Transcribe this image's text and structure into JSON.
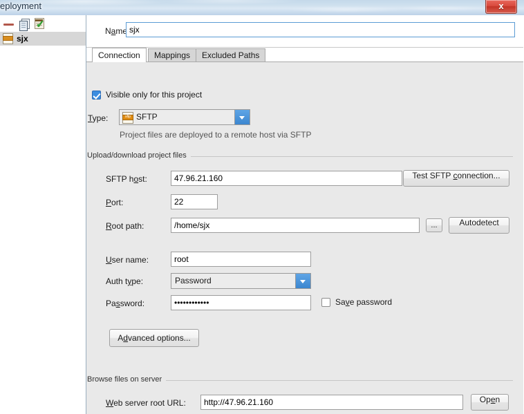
{
  "window": {
    "title": "eployment",
    "close_label": "x"
  },
  "sidebar": {
    "toolbar": [
      {
        "name": "remove-server-icon",
        "label": "Remove"
      },
      {
        "name": "copy-server-icon",
        "label": "Copy"
      },
      {
        "name": "set-default-server-icon",
        "label": "Use as default"
      }
    ],
    "items": [
      {
        "label": "sjx",
        "icon": "sftp-server-icon",
        "selected": true
      }
    ]
  },
  "name_field": {
    "label_pre": "N",
    "label_mn": "a",
    "label_post": "me:",
    "value": "sjx"
  },
  "tabs": [
    {
      "label": "Connection",
      "active": true
    },
    {
      "label": "Mappings",
      "active": false
    },
    {
      "label": "Excluded Paths",
      "active": false
    }
  ],
  "connection": {
    "visible_only_checkbox": {
      "label": "Visible only for this project",
      "checked": true
    },
    "type": {
      "label_pre": "",
      "label_mn": "T",
      "label_post": "ype:",
      "value": "SFTP",
      "icon": "sftp-file-icon",
      "description": "Project files are deployed to a remote host via SFTP"
    },
    "upload_group": {
      "title": "Upload/download project files",
      "host": {
        "label_pre": "SFTP h",
        "label_mn": "o",
        "label_post": "st:",
        "value": "47.96.21.160"
      },
      "test_button": {
        "label_pre": "Test SFTP ",
        "label_mn": "c",
        "label_post": "onnection..."
      },
      "port": {
        "label_pre": "",
        "label_mn": "P",
        "label_post": "ort:",
        "value": "22"
      },
      "root_path": {
        "label_pre": "",
        "label_mn": "R",
        "label_post": "oot path:",
        "value": "/home/sjx",
        "browse_label": "..."
      },
      "autodetect_button": {
        "label": "Autodetect"
      },
      "user_name": {
        "label_pre": "",
        "label_mn": "U",
        "label_post": "ser name:",
        "value": "root"
      },
      "auth_type": {
        "label_pre": "Auth t",
        "label_mn": "y",
        "label_post": "pe:",
        "value": "Password"
      },
      "password": {
        "label_pre": "Pa",
        "label_mn": "s",
        "label_post": "sword:",
        "value": "••••••••••••"
      },
      "save_password": {
        "label_pre": "Sa",
        "label_mn": "v",
        "label_post": "e password",
        "checked": false
      },
      "advanced_button": {
        "label_pre": "A",
        "label_mn": "d",
        "label_post": "vanced options..."
      }
    },
    "browse_group": {
      "title": "Browse files on server",
      "web_root": {
        "label_pre": "",
        "label_mn": "W",
        "label_post": "eb server root URL:",
        "value": "http://47.96.21.160"
      },
      "open_button": {
        "label_pre": "Op",
        "label_mn": "e",
        "label_post": "n"
      }
    }
  }
}
